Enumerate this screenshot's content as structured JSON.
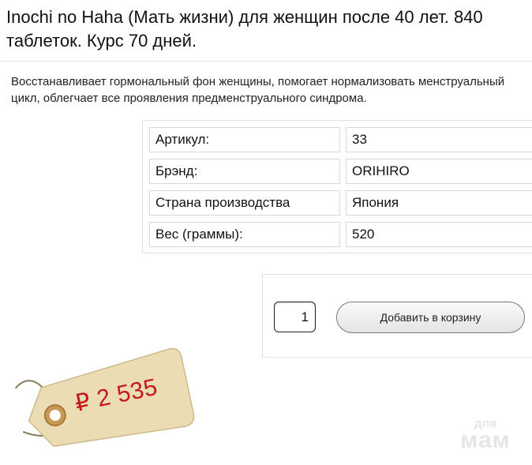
{
  "product": {
    "title": "Inochi no Haha (Мать жизни) для женщин после 40 лет. 840 таблеток. Курс 70 дней.",
    "description": "Восстанавливает гормональный фон женщины, помогает нормализовать менструальный цикл, облегчает все проявления предменструального синдрома."
  },
  "properties": [
    {
      "key": "Артикул:",
      "value": "33"
    },
    {
      "key": "Брэнд:",
      "value": "ORIHIRO"
    },
    {
      "key": "Страна производства",
      "value": "Япония"
    },
    {
      "key": "Вес (граммы):",
      "value": "520"
    }
  ],
  "cart": {
    "quantity": "1",
    "add_button_label": "Добавить в корзину"
  },
  "price_tag": {
    "price": "₽ 2 535",
    "price_color": "#c31a1a",
    "tag_color": "#ecdcb4"
  },
  "watermark": {
    "line1": "для",
    "line2": "мам"
  }
}
